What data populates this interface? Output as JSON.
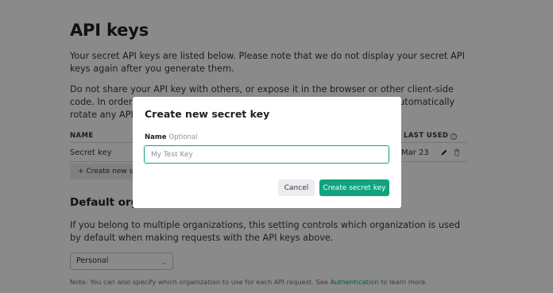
{
  "page": {
    "title": "API keys",
    "intro": "Your secret API keys are listed below. Please note that we do not display your secret API keys again after you generate them.",
    "warning": "Do not share your API key with others, or expose it in the browser or other client-side code. In order to protect the security of your account, OpenAI may also automatically rotate any API key that we've found has leaked publicly.",
    "table": {
      "col_name": "NAME",
      "col_last_used": "LAST USED",
      "rows": [
        {
          "name": "Secret key",
          "last_used": "Mar 23"
        }
      ]
    },
    "create_button": "+ Create new secret key",
    "default_org": {
      "heading": "Default organization",
      "description": "If you belong to multiple organizations, this setting controls which organization is used by default when making requests with the API keys above.",
      "selected": "Personal",
      "note_prefix": "Note: You can also specify which organization to use for each API request. See ",
      "note_link": "Authentication",
      "note_suffix": " to learn more."
    }
  },
  "modal": {
    "title": "Create new secret key",
    "field_label": "Name",
    "field_optional": "Optional",
    "field_placeholder": "My Test Key",
    "cancel_label": "Cancel",
    "submit_label": "Create secret key"
  },
  "colors": {
    "accent": "#10a37f",
    "overlay": "rgba(0,0,0,0.46)"
  }
}
